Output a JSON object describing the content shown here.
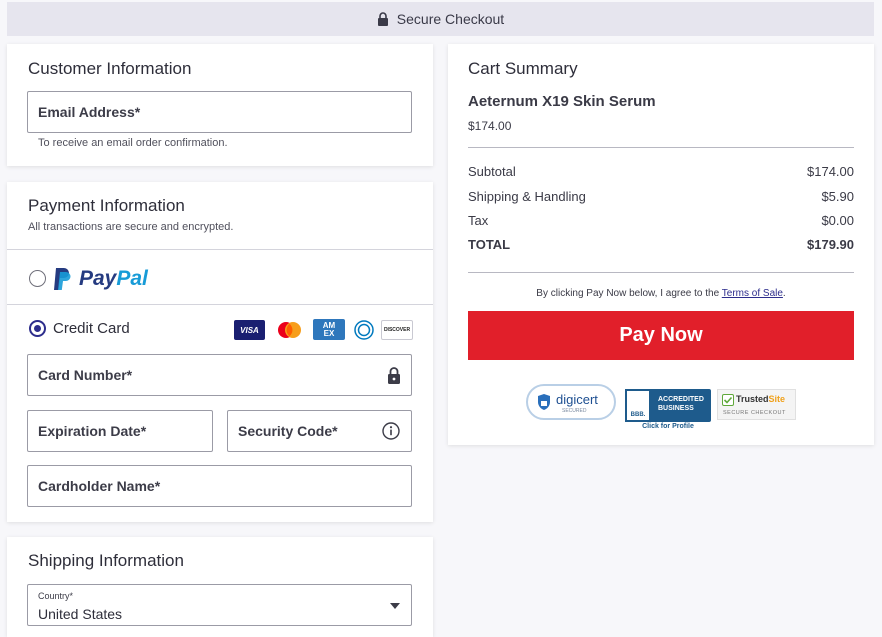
{
  "topbar": {
    "title": "Secure Checkout"
  },
  "customer": {
    "title": "Customer Information",
    "email_label": "Email Address*",
    "email_hint": "To receive an email order confirmation."
  },
  "payment": {
    "title": "Payment Information",
    "subtitle": "All transactions are secure and encrypted.",
    "paypal_brand_1": "Pay",
    "paypal_brand_2": "Pal",
    "credit_card_label": "Credit Card",
    "card_logos": {
      "visa": "VISA",
      "amex_1": "AM",
      "amex_2": "EX",
      "discover": "DISCOVER"
    },
    "card_number_label": "Card Number*",
    "expiration_label": "Expiration Date*",
    "security_label": "Security Code*",
    "cardholder_label": "Cardholder Name*",
    "selected_method": "credit_card"
  },
  "shipping": {
    "title": "Shipping Information",
    "country_label": "Country*",
    "country_value": "United States"
  },
  "cart": {
    "title": "Cart Summary",
    "product_name": "Aeternum X19 Skin Serum",
    "product_price": "$174.00",
    "rows": [
      {
        "label": "Subtotal",
        "value": "$174.00"
      },
      {
        "label": "Shipping & Handling",
        "value": "$5.90"
      },
      {
        "label": "Tax",
        "value": "$0.00"
      }
    ],
    "total_label": "TOTAL",
    "total_value": "$179.90",
    "terms_prefix": "By clicking Pay Now below, I agree to the",
    "terms_link": "Terms of Sale",
    "terms_suffix": ".",
    "pay_button": "Pay Now"
  },
  "badges": {
    "digicert": "digicert",
    "digicert_sub": "SECURED",
    "bbb_line1": "ACCREDITED",
    "bbb_line2": "BUSINESS",
    "bbb_logo": "BBB.",
    "bbb_caption": "Click for Profile",
    "trustedsite_1": "Trusted",
    "trustedsite_2": "Site",
    "trustedsite_sub": "SECURE CHECKOUT"
  },
  "colors": {
    "accent_red": "#e11f2a",
    "radio_navy": "#2d2d8c",
    "paypal_dark": "#253b80",
    "paypal_light": "#179bd7"
  }
}
